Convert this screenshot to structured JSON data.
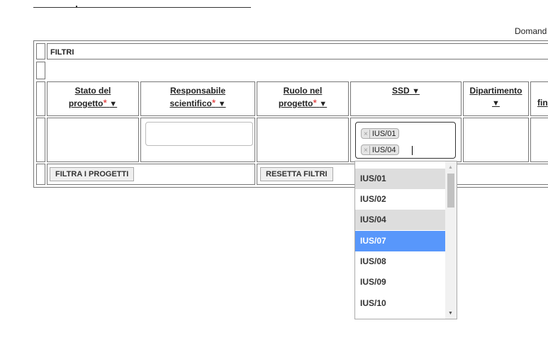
{
  "header": {
    "domanda_label": "Domand"
  },
  "filters": {
    "title": "FILTRI",
    "columns": [
      {
        "line1": "Stato del",
        "line2": "progetto",
        "required": true,
        "arrow": "▼"
      },
      {
        "line1": "Responsabile",
        "line2": "scientifico",
        "required": true,
        "arrow": "▼"
      },
      {
        "line1": "Ruolo nel",
        "line2": "progetto",
        "required": true,
        "arrow": "▼"
      },
      {
        "line1": "SSD",
        "line2": "",
        "required": false,
        "arrow": "▼"
      },
      {
        "line1": "Dipartimento",
        "line2": "",
        "required": false,
        "arrow": "▼"
      },
      {
        "line1": "",
        "line2": "fin",
        "required": false,
        "arrow": ""
      }
    ],
    "ssd_selected": [
      "IUS/01",
      "IUS/04"
    ],
    "filter_button": "FILTRA I PROGETTI",
    "reset_button": "RESETTA FILTRI"
  },
  "dropdown": {
    "options": [
      {
        "label": "IUS/01",
        "state": "selected"
      },
      {
        "label": "IUS/02",
        "state": ""
      },
      {
        "label": "IUS/04",
        "state": "selected"
      },
      {
        "label": "IUS/07",
        "state": "highlighted"
      },
      {
        "label": "IUS/08",
        "state": ""
      },
      {
        "label": "IUS/09",
        "state": ""
      },
      {
        "label": "IUS/10",
        "state": ""
      }
    ]
  },
  "colors": {
    "highlight": "#5897fb",
    "selected": "#dddddd",
    "required_star": "#dd2222"
  },
  "icons": {
    "remove_tag": "close-icon",
    "sort_arrow": "triangle-down-icon",
    "scroll_up": "scroll-up-icon",
    "scroll_down": "scroll-down-icon"
  }
}
